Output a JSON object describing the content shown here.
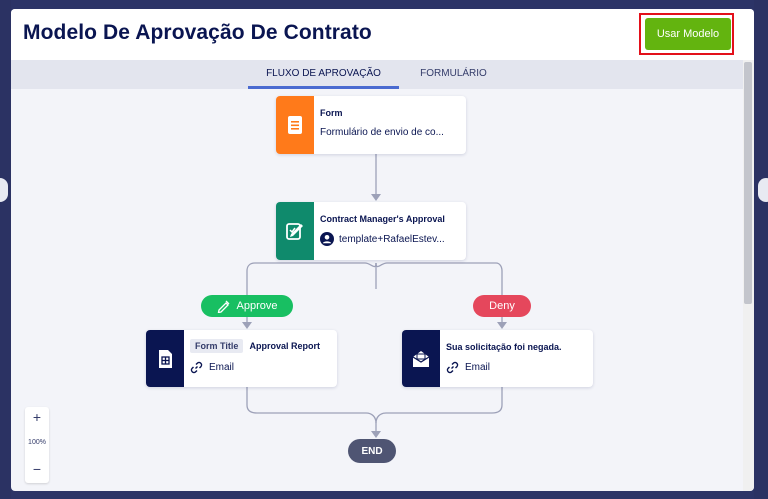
{
  "modal": {
    "title": "Modelo De Aprovação De Contrato",
    "use_template_label": "Usar Modelo"
  },
  "tabs": [
    {
      "label": "FLUXO DE APROVAÇÃO",
      "active": true
    },
    {
      "label": "FORMULÁRIO",
      "active": false
    }
  ],
  "flow": {
    "form_node": {
      "title": "Form",
      "subtitle": "Formulário de envio de co...",
      "icon": "form-icon",
      "color": "#ff7a1a"
    },
    "approval_node": {
      "title": "Contract Manager's Approval",
      "assignee": "template+RafaelEstev...",
      "icon": "approval-icon",
      "color": "#0f8a6c"
    },
    "approve_label": "Approve",
    "deny_label": "Deny",
    "approve_node": {
      "tag": "Form Title",
      "title": "Approval Report",
      "action": "Email",
      "icon": "report-icon",
      "color": "#0a1551"
    },
    "deny_node": {
      "title": "Sua solicitação foi negada.",
      "action": "Email",
      "icon": "mail-icon",
      "color": "#0a1551"
    },
    "end_label": "END"
  },
  "zoom": {
    "plus": "+",
    "level": "100%",
    "minus": "−"
  },
  "colors": {
    "accent": "#4a6ad0",
    "approve": "#18bf62",
    "deny": "#e5475c",
    "use_button": "#63b40f",
    "highlight": "#e3101a"
  }
}
